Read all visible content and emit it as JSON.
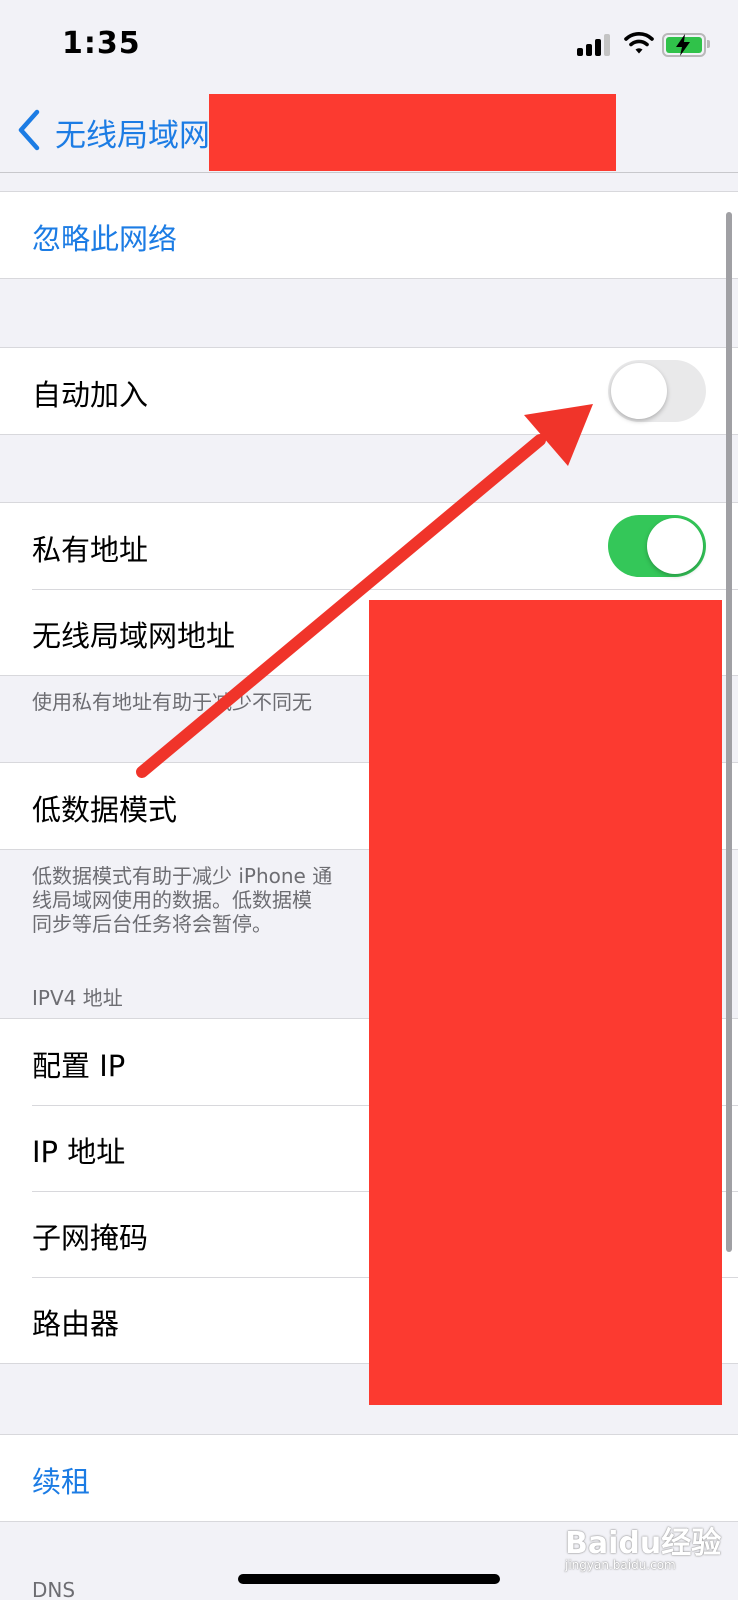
{
  "status_bar": {
    "time": "1:35"
  },
  "nav": {
    "back_label": "无线局域网"
  },
  "rows": {
    "forget_network": "忽略此网络",
    "auto_join": "自动加入",
    "private_address": "私有地址",
    "wifi_address": "无线局域网地址",
    "low_data_mode": "低数据模式",
    "configure_ip": "配置 IP",
    "ip_address": "IP 地址",
    "subnet_mask": "子网掩码",
    "router": "路由器",
    "renew_lease": "续租"
  },
  "toggles": {
    "auto_join_on": false,
    "private_address_on": true
  },
  "footnotes": {
    "private_address_note": "使用私有地址有助于减少不同无",
    "low_data_note_1": "低数据模式有助于减少 iPhone 通",
    "low_data_note_2": "线局域网使用的数据。低数据模",
    "low_data_note_3": "同步等后台任务将会暂停。"
  },
  "sections": {
    "ipv4_header": "IPV4 地址",
    "dns_header": "DNS"
  },
  "watermark": {
    "brand": "Baidu经验",
    "domain": "jingyan.baidu.com"
  },
  "colors": {
    "accent_blue": "#1c7ce4",
    "toggle_on_green": "#34c759",
    "annotation_red": "#f0342a",
    "redaction_red": "#fc3a30"
  },
  "icons": {
    "back": "chevron-left-icon",
    "signal": "cellular-signal-icon",
    "wifi": "wifi-icon",
    "battery": "battery-charging-icon"
  }
}
